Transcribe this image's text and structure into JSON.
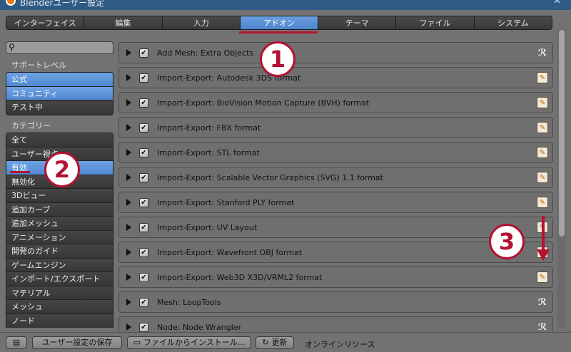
{
  "window": {
    "title": "Blenderユーザー設定",
    "close_glyph": "✕"
  },
  "tabs": [
    {
      "label": "インターフェイス"
    },
    {
      "label": "編集"
    },
    {
      "label": "入力"
    },
    {
      "label": "アドオン",
      "active": true
    },
    {
      "label": "テーマ"
    },
    {
      "label": "ファイル"
    },
    {
      "label": "システム"
    }
  ],
  "sidebar": {
    "search_icon": "magnifier-icon",
    "support_label": "サポートレベル",
    "support": [
      {
        "label": "公式",
        "on": true
      },
      {
        "label": "コミュニティ",
        "on": true
      },
      {
        "label": "テスト中",
        "on": false
      }
    ],
    "category_label": "カテゴリー",
    "categories": [
      {
        "label": "全て",
        "on": false
      },
      {
        "label": "ユーザー視点",
        "on": false
      },
      {
        "label": "有効",
        "on": true
      },
      {
        "label": "無効化",
        "on": false
      },
      {
        "label": "3Dビュー",
        "on": false
      },
      {
        "label": "追加カーブ",
        "on": false
      },
      {
        "label": "追加メッシュ",
        "on": false
      },
      {
        "label": "アニメーション",
        "on": false
      },
      {
        "label": "開発のガイド",
        "on": false
      },
      {
        "label": "ゲームエンジン",
        "on": false
      },
      {
        "label": "インポート/エクスポート",
        "on": false
      },
      {
        "label": "マテリアル",
        "on": false
      },
      {
        "label": "メッシュ",
        "on": false
      },
      {
        "label": "ノード",
        "on": false
      }
    ]
  },
  "addons": [
    {
      "name": "Add Mesh: Extra Objects",
      "checked": true,
      "icon": "user-icon"
    },
    {
      "name": "Import-Export: Autodesk 3DS format",
      "checked": true,
      "icon": "file-icon"
    },
    {
      "name": "Import-Export: BioVision Motion Capture (BVH) format",
      "checked": true,
      "icon": "file-icon"
    },
    {
      "name": "Import-Export: FBX format",
      "checked": true,
      "icon": "file-icon"
    },
    {
      "name": "Import-Export: STL format",
      "checked": true,
      "icon": "file-icon"
    },
    {
      "name": "Import-Export: Scalable Vector Graphics (SVG) 1.1 format",
      "checked": true,
      "icon": "file-icon"
    },
    {
      "name": "Import-Export: Stanford PLY format",
      "checked": true,
      "icon": "file-icon"
    },
    {
      "name": "Import-Export: UV Layout",
      "checked": true,
      "icon": "file-icon"
    },
    {
      "name": "Import-Export: Wavefront OBJ format",
      "checked": true,
      "icon": "file-icon"
    },
    {
      "name": "Import-Export: Web3D X3D/VRML2 format",
      "checked": true,
      "icon": "file-icon"
    },
    {
      "name": "Mesh: LoopTools",
      "checked": true,
      "icon": "user-icon"
    },
    {
      "name": "Node: Node Wrangler",
      "checked": true,
      "icon": "user-icon"
    }
  ],
  "footer": {
    "save_label": "ユーザー設定の保存",
    "install_label": "ファイルからインストール...",
    "refresh_label": "更新",
    "online_label": "オンラインリソース"
  },
  "annotations": {
    "step1": "1",
    "step2": "2",
    "step3": "3",
    "color": "#b31231"
  },
  "glyphs": {
    "check": "✔",
    "file_icon": "✎",
    "user_icon": "ℛ",
    "magnifier": "⚲",
    "refresh": "↻",
    "folder": "▭",
    "prefs": "▤"
  }
}
